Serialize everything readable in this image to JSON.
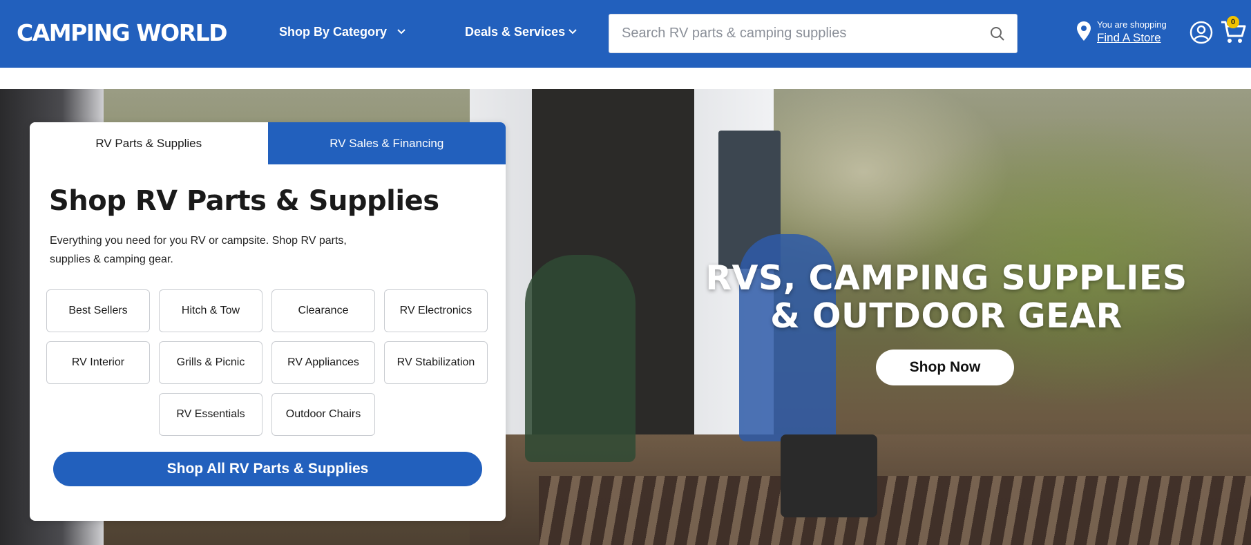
{
  "header": {
    "logo": "CAMPING WORLD",
    "nav": {
      "shop_by_category": "Shop By Category",
      "deals_services": "Deals & Services"
    },
    "search": {
      "placeholder": "Search RV parts & camping supplies"
    },
    "store": {
      "line1": "You are shopping",
      "link": "Find A Store"
    },
    "cart_count": "0"
  },
  "hero": {
    "title_line1": "RVS, CAMPING SUPPLIES",
    "title_line2": "& OUTDOOR GEAR",
    "cta": "Shop Now"
  },
  "card": {
    "tabs": [
      "RV Parts & Supplies",
      "RV Sales & Financing"
    ],
    "active_tab": "RV Parts & Supplies",
    "heading": "Shop RV Parts & Supplies",
    "description_line1": "Everything you need for you RV or campsite. Shop RV parts,",
    "description_line2": "supplies & camping gear.",
    "categories": [
      "Best Sellers",
      "Hitch & Tow",
      "Clearance",
      "RV Electronics",
      "RV Interior",
      "Grills & Picnic",
      "RV Appliances",
      "RV Stabilization",
      "RV Essentials",
      "Outdoor Chairs"
    ],
    "shop_all": "Shop All RV Parts & Supplies"
  },
  "colors": {
    "brand_blue": "#2260bd",
    "cart_badge": "#f2c300"
  }
}
